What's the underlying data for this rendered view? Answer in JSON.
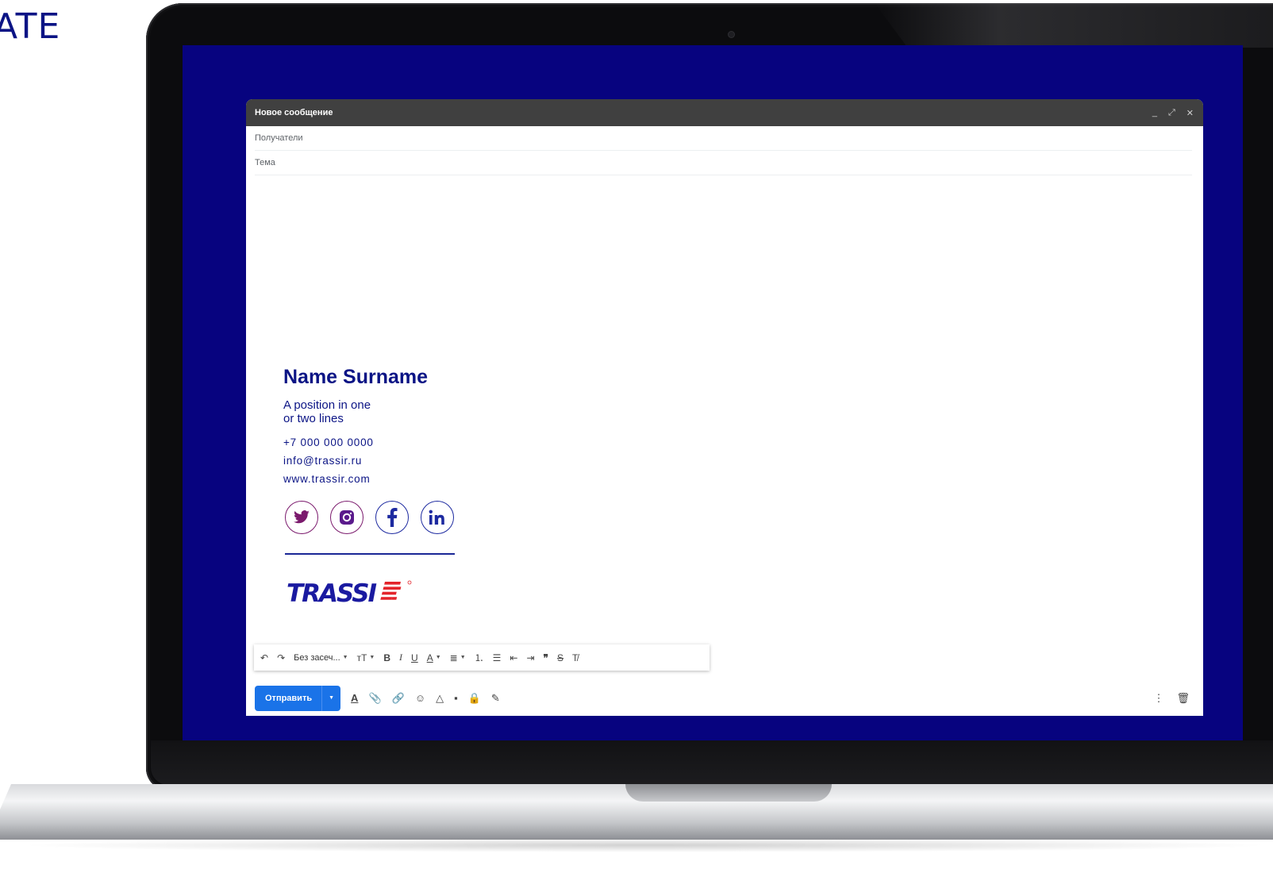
{
  "page": {
    "corner_text": "ATE"
  },
  "compose": {
    "title": "Новое сообщение",
    "header_icons": [
      "minimize-icon",
      "expand-icon",
      "close-icon"
    ],
    "recipients_label": "Получатели",
    "subject_label": "Тема"
  },
  "signature": {
    "name": "Name Surname",
    "position": "A position in one\nor two lines",
    "phone": "+7 000 000 0000",
    "email": "info@trassir.ru",
    "website": "www.trassir.com",
    "socials": [
      "twitter-icon",
      "instagram-icon",
      "facebook-icon",
      "linkedin-icon"
    ],
    "logo_text": "TRASSIR",
    "brand_colors": {
      "navy": "#0b1485",
      "red": "#e3242b",
      "magenta": "#7b1a6d"
    }
  },
  "toolbar": {
    "font_name": "Без засеч...",
    "bold": "B",
    "italic": "I",
    "underline": "U",
    "text_color": "A",
    "quote": "❞"
  },
  "bottom": {
    "send_label": "Отправить",
    "text_format_label": "A"
  },
  "colors": {
    "screen_bg": "#07037f",
    "send_blue": "#1a73e8",
    "header_gray": "#404040"
  }
}
